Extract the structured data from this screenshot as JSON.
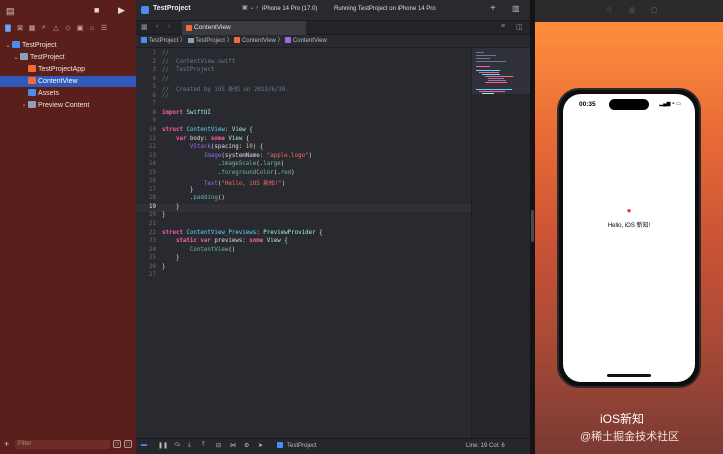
{
  "navigator": {
    "project_name": "TestProject",
    "group_name": "TestProject",
    "items": [
      {
        "label": "TestProjectApp"
      },
      {
        "label": "ContentView"
      },
      {
        "label": "Assets"
      },
      {
        "label": "Preview Content"
      }
    ],
    "filter_placeholder": "Filter"
  },
  "toolbar": {
    "scheme": "TestProject",
    "destination": "iPhone 14 Pro (17.0)",
    "status": "Running TestProject on iPhone 14 Pro"
  },
  "editor": {
    "tab_label": "ContentView",
    "breadcrumb": [
      "TestProject",
      "TestProject",
      "ContentView",
      "ContentView"
    ],
    "current_line": 19,
    "status_scheme": "TestProject",
    "cursor": "Line: 19  Col: 6"
  },
  "code_lines": [
    "//",
    "//  ContentView.swift",
    "//  TestProject",
    "//",
    "//  Created by iOS 新知 on 2023/6/30.",
    "//",
    "",
    "import SwiftUI",
    "",
    "struct ContentView: View {",
    "    var body: some View {",
    "        VStack(spacing: 10) {",
    "            Image(systemName: \"apple.logo\")",
    "                .imageScale(.large)",
    "                .foregroundColor(.red)",
    "            Text(\"Hello, iOS 新知!\")",
    "        }",
    "        .padding()",
    "    }",
    "}",
    "",
    "struct ContentView_Previews: PreviewProvider {",
    "    static var previews: some View {",
    "        ContentView()",
    "    }",
    "}",
    ""
  ],
  "preview": {
    "time": "00:35",
    "greeting": "Hello, iOS 新知!"
  },
  "watermark": {
    "line1": "iOS新知",
    "line2": "@稀土掘金技术社区"
  },
  "colors": {
    "sidebar_bg": "#5a1f1b",
    "selection": "#2f5ab9",
    "editor_bg": "#292a30",
    "apple_logo": "#e53935"
  }
}
